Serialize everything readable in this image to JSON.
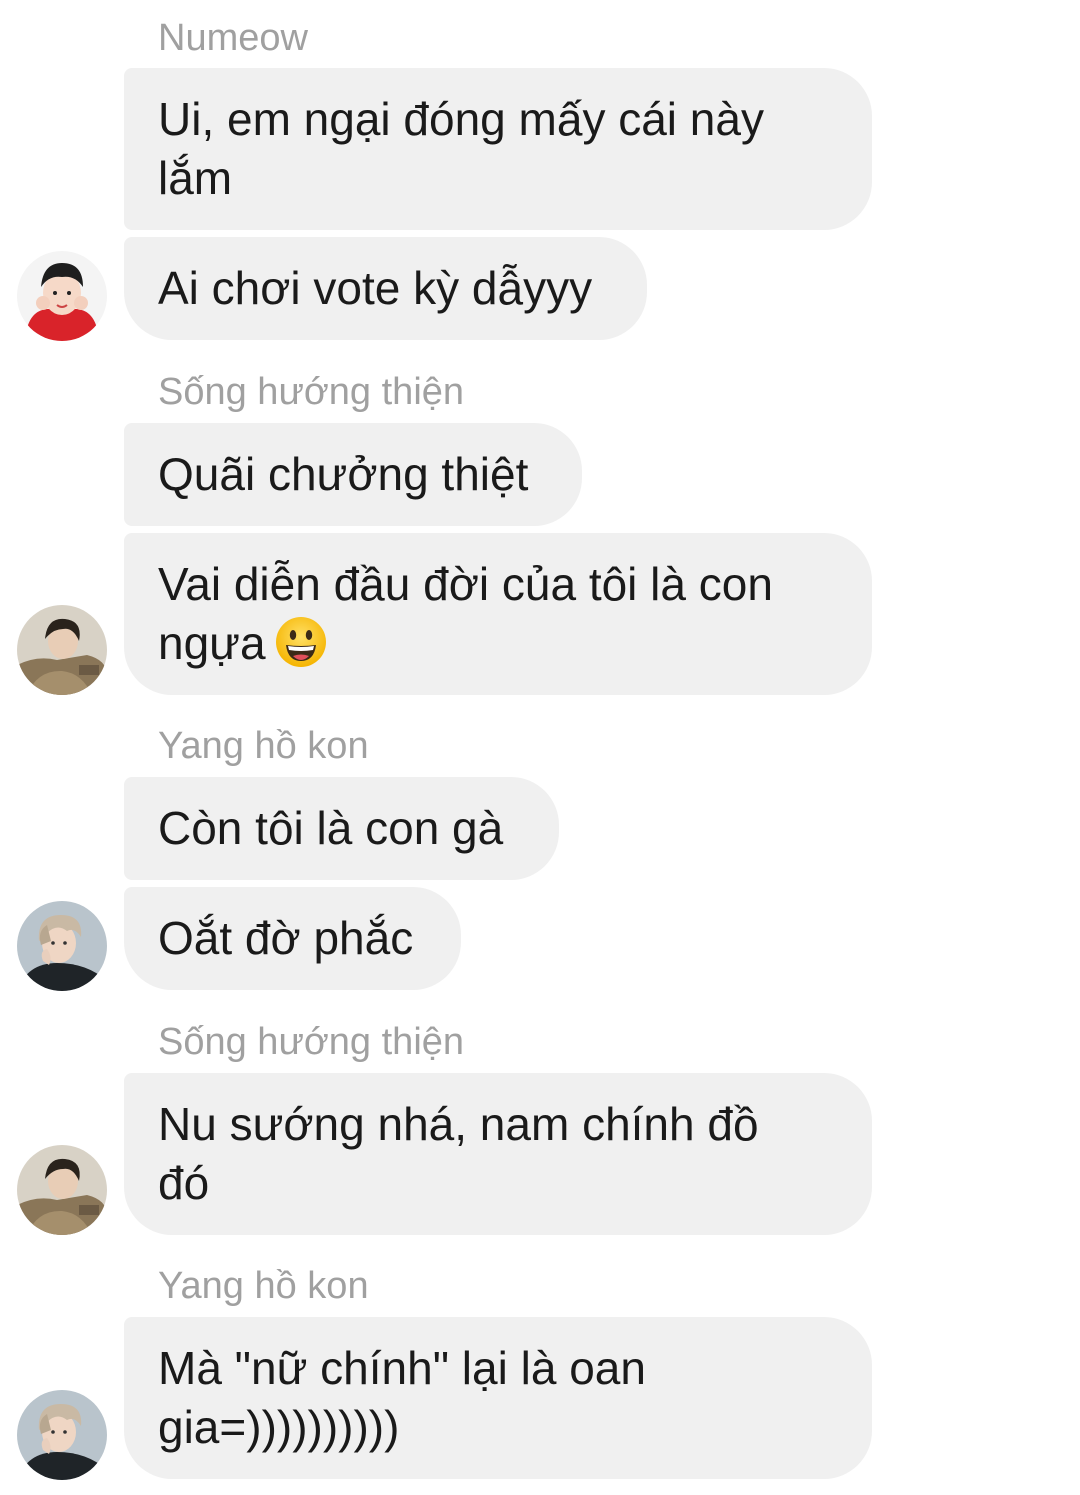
{
  "messages": [
    {
      "sender": "Numeow",
      "bubbles": [
        "Ui, em ngại đóng mấy cái này\nlắm",
        "Ai chơi vote kỳ dẫyyy"
      ]
    },
    {
      "sender": "Sống hướng thiện",
      "bubbles": [
        "Quãi chưởng thiệt",
        "Vai diễn đầu đời của tôi là con\nngựa"
      ],
      "emoji": "grinning-face-emoji"
    },
    {
      "sender": "Yang hồ kon",
      "bubbles": [
        "Còn tôi là con gà",
        "Oắt đờ phắc"
      ]
    },
    {
      "sender": "Sống hướng thiện",
      "bubbles": [
        "Nu sướng nhá, nam chính đồ\nđó"
      ]
    },
    {
      "sender": "Yang hồ kon",
      "bubbles": [
        "Mà \"nữ chính\" lại là oan\ngia=))))))))))"
      ]
    }
  ],
  "colors": {
    "bubble_bg": "#f0f0f0",
    "sender_text": "#a0a0a0",
    "message_text": "#1a1a1a"
  }
}
